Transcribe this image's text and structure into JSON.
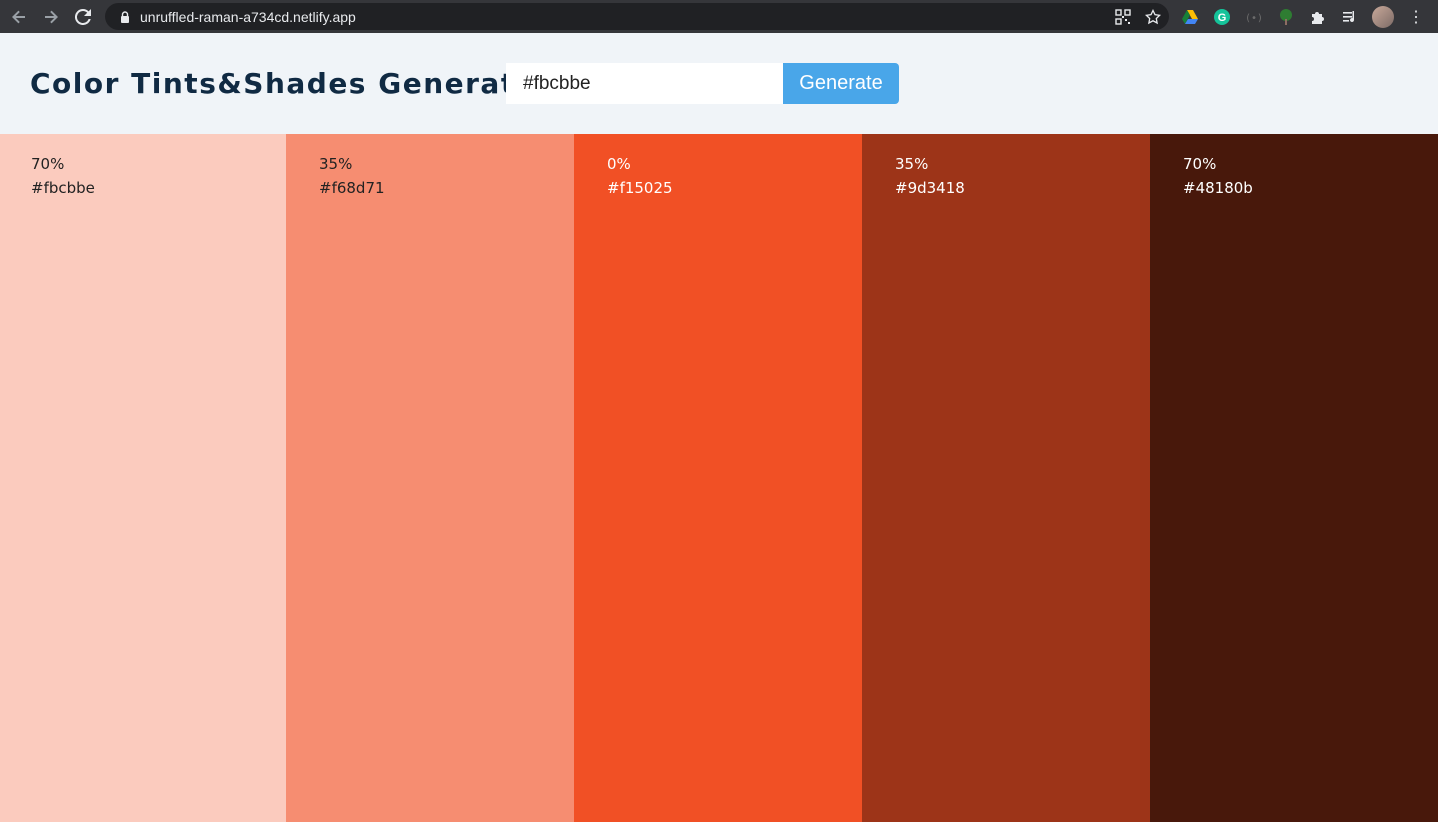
{
  "browser": {
    "url": "unruffled-raman-a734cd.netlify.app"
  },
  "app": {
    "title": "Color Tints&Shades Generator",
    "input_value": "#fbcbbe",
    "generate_label": "Generate"
  },
  "swatches": [
    {
      "percent": "70%",
      "hex": "#fbcbbe",
      "color": "#fbcbbe",
      "text_color": "#222222"
    },
    {
      "percent": "35%",
      "hex": "#f68d71",
      "color": "#f68d71",
      "text_color": "#222222"
    },
    {
      "percent": "0%",
      "hex": "#f15025",
      "color": "#f15025",
      "text_color": "#ffffff"
    },
    {
      "percent": "35%",
      "hex": "#9d3418",
      "color": "#9d3418",
      "text_color": "#ffffff"
    },
    {
      "percent": "70%",
      "hex": "#48180b",
      "color": "#48180b",
      "text_color": "#ffffff"
    }
  ]
}
